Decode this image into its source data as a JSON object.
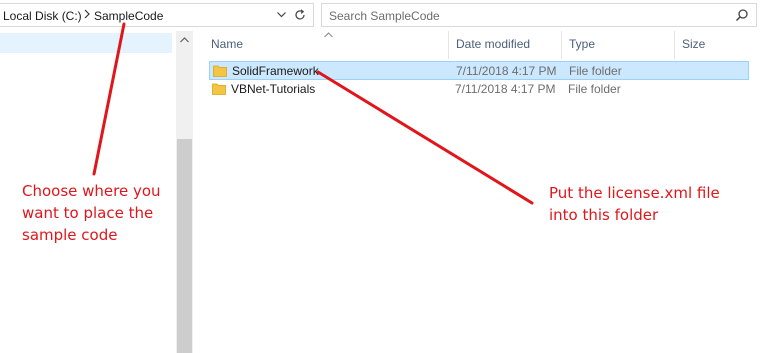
{
  "address": {
    "crumbs": [
      "Local Disk (C:)",
      "SampleCode"
    ],
    "dropdown_icon": "chevron-down-icon",
    "refresh_icon": "refresh-icon"
  },
  "search": {
    "placeholder": "Search SampleCode",
    "icon": "search-icon"
  },
  "columns": {
    "name": "Name",
    "date_modified": "Date modified",
    "type": "Type",
    "size": "Size"
  },
  "files": [
    {
      "name": "SolidFramework",
      "date": "7/11/2018 4:17 PM",
      "type": "File folder",
      "size": "",
      "selected": true
    },
    {
      "name": "VBNet-Tutorials",
      "date": "7/11/2018 4:17 PM",
      "type": "File folder",
      "size": "",
      "selected": false
    }
  ],
  "annotations": {
    "left_note": [
      "Choose where you",
      "want to place the",
      "sample code"
    ],
    "right_note": [
      "Put the license.xml file",
      "into this folder"
    ],
    "color": "#e0161b"
  },
  "colors": {
    "selection_bg": "#cce8ff",
    "selection_border": "#99d1ff",
    "folder": "#f4c542",
    "header_text": "#4c607a"
  }
}
